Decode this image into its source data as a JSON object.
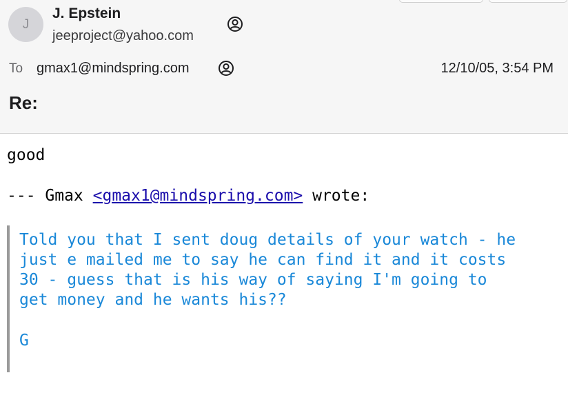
{
  "sender": {
    "avatar_initial": "J",
    "name": "J. Epstein",
    "email": "jeeproject@yahoo.com"
  },
  "recipient": {
    "label": "To",
    "email": "gmax1@mindspring.com"
  },
  "date": "12/10/05, 3:54 PM",
  "subject": "Re:",
  "body": {
    "reply": "good",
    "attribution_prefix": "--- Gmax ",
    "attribution_link": "<gmax1@mindspring.com>",
    "attribution_suffix": " wrote:",
    "quoted_lines": [
      "Told you that I sent doug details of your watch - he",
      "just e mailed me to say he can find it and it costs",
      "30 - guess that is his way of saying I'm going to",
      "get money and he wants his??",
      "G"
    ]
  },
  "colors": {
    "header_bg": "#f6f6f6",
    "quote_text": "#1a88d8",
    "link": "#1a0dab",
    "quote_bar": "#9a9a9a"
  },
  "icons": {
    "contact": "person-circle-icon"
  }
}
